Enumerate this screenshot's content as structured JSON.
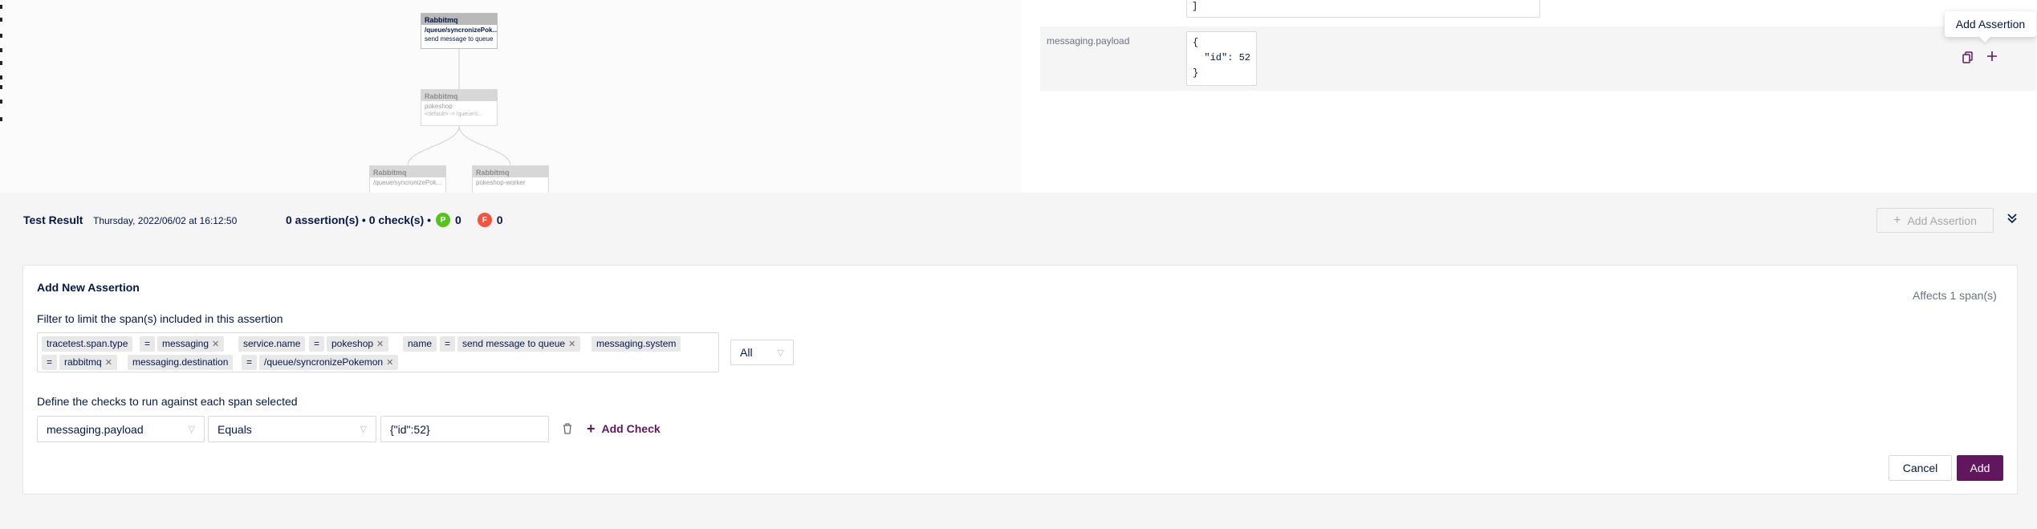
{
  "diagram": {
    "node_active": {
      "type": "Rabbitmq",
      "line1": "/queue/syncronizePok...",
      "line2": "send message to queue"
    },
    "node_pokeshop": {
      "type": "Rabbitmq",
      "line1": "pokeshop",
      "line2": "<default> -> /queue/s..."
    },
    "node_left": {
      "type": "Rabbitmq",
      "line1": "/queue/syncronizePok..."
    },
    "node_right": {
      "type": "Rabbitmq",
      "line1": "pokeshop-worker"
    }
  },
  "attributes": {
    "prev_value_tail": "]",
    "payload_key": "messaging.payload",
    "payload_lines": [
      "{",
      "  \"id\": 52",
      "}"
    ],
    "tooltip": "Add Assertion",
    "copy_icon": "copy-icon",
    "add_icon": "plus-icon"
  },
  "result": {
    "title": "Test Result",
    "timestamp": "Thursday, 2022/06/02 at 16:12:50",
    "summary": "0 assertion(s) • 0 check(s) •",
    "passed_badge": "P",
    "passed_count": "0",
    "failed_badge": "F",
    "failed_count": "0",
    "add_assertion_label": "Add Assertion",
    "colors": {
      "pass": "#52c41a",
      "fail": "#f5533d",
      "brand": "#61175e"
    }
  },
  "form": {
    "title": "Add New Assertion",
    "affects": "Affects 1 span(s)",
    "filter_label": "Filter to limit the span(s) included in this assertion",
    "filter_tags": [
      "tracetest.span.type",
      "=",
      "messaging",
      "service.name",
      "=",
      "pokeshop",
      "name",
      "=",
      "send message to queue",
      "messaging.system",
      "=",
      "rabbitmq",
      "messaging.destination",
      "=",
      "/queue/syncronizePokemon"
    ],
    "scope_value": "All",
    "checks_label": "Define the checks to run against each span selected",
    "check_attribute": "messaging.payload",
    "check_operator": "Equals",
    "check_value": "{\"id\":52}",
    "add_check_label": "Add Check",
    "cancel_label": "Cancel",
    "add_label": "Add"
  }
}
